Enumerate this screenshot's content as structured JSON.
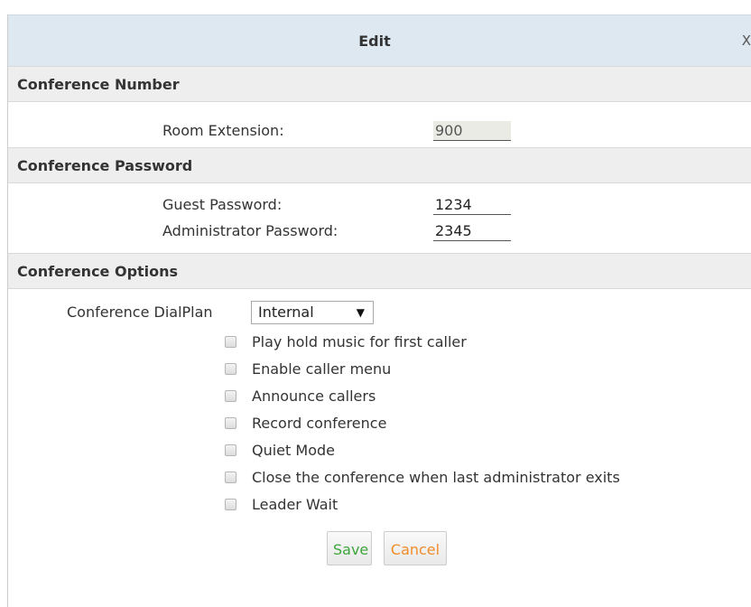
{
  "dialog": {
    "title": "Edit",
    "close_label": "X"
  },
  "sections": {
    "number": {
      "header": "Conference Number",
      "room_extension": {
        "label": "Room Extension:",
        "value": "900"
      }
    },
    "password": {
      "header": "Conference Password",
      "guest_password": {
        "label": "Guest Password:",
        "value": "1234"
      },
      "admin_password": {
        "label": "Administrator Password:",
        "value": "2345"
      }
    },
    "options": {
      "header": "Conference Options",
      "dialplan": {
        "label": "Conference DialPlan",
        "selected": "Internal"
      },
      "checkboxes": [
        {
          "label": "Play hold music for first caller",
          "checked": false
        },
        {
          "label": "Enable caller menu",
          "checked": false
        },
        {
          "label": "Announce callers",
          "checked": false
        },
        {
          "label": "Record conference",
          "checked": false
        },
        {
          "label": "Quiet Mode",
          "checked": false
        },
        {
          "label": "Close the conference when last administrator exits",
          "checked": false
        },
        {
          "label": "Leader Wait",
          "checked": false
        }
      ]
    }
  },
  "buttons": {
    "save_label": "Save",
    "cancel_label": "Cancel"
  },
  "colors": {
    "save_text": "#3da63d",
    "cancel_text": "#f08c2a",
    "title_bg": "#dde8f1",
    "section_bg": "#eeeeee"
  },
  "icons": {
    "close": "close-icon",
    "dropdown": "caret-down-icon"
  }
}
